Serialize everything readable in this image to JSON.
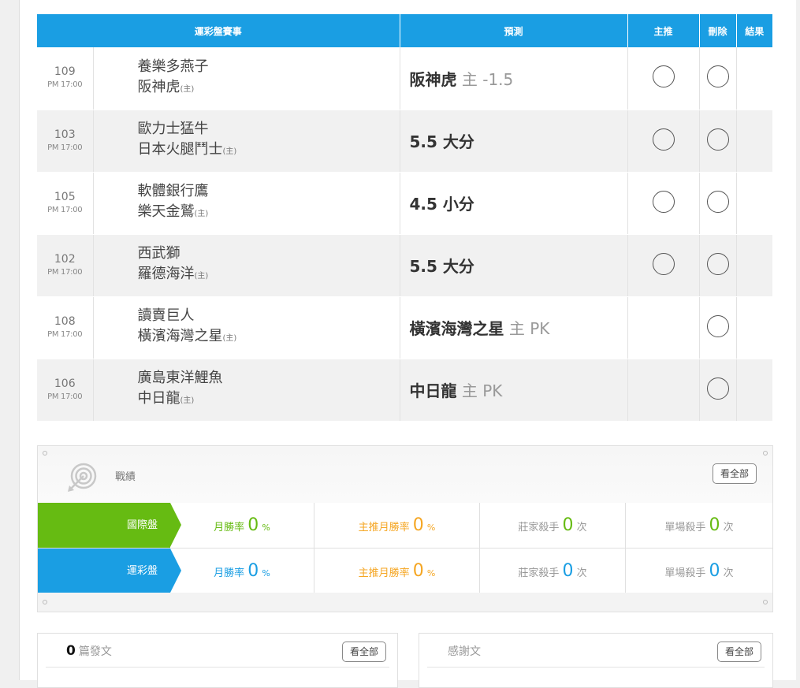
{
  "table": {
    "headers": {
      "event": "運彩盤賽事",
      "prediction": "預測",
      "main": "主推",
      "delete": "刪除",
      "result": "結果"
    },
    "rows": [
      {
        "num": "109",
        "time": "PM 17:00",
        "away": "養樂多燕子",
        "home": "阪神虎",
        "host_mark": "(主)",
        "pred_main": "阪神虎",
        "pred_host": "主",
        "pred_line": "-1.5",
        "has_main_radio": true
      },
      {
        "num": "103",
        "time": "PM 17:00",
        "away": "歐力士猛牛",
        "home": "日本火腿鬥士",
        "host_mark": "(主)",
        "pred_main": "5.5 大分",
        "pred_host": "",
        "pred_line": "",
        "has_main_radio": true
      },
      {
        "num": "105",
        "time": "PM 17:00",
        "away": "軟體銀行鷹",
        "home": "樂天金鷲",
        "host_mark": "(主)",
        "pred_main": "4.5 小分",
        "pred_host": "",
        "pred_line": "",
        "has_main_radio": true
      },
      {
        "num": "102",
        "time": "PM 17:00",
        "away": "西武獅",
        "home": "羅德海洋",
        "host_mark": "(主)",
        "pred_main": "5.5 大分",
        "pred_host": "",
        "pred_line": "",
        "has_main_radio": true
      },
      {
        "num": "108",
        "time": "PM 17:00",
        "away": "讀賣巨人",
        "home": "橫濱海灣之星",
        "host_mark": "(主)",
        "pred_main": "橫濱海灣之星",
        "pred_host": "主",
        "pred_line": "PK",
        "has_main_radio": false
      },
      {
        "num": "106",
        "time": "PM 17:00",
        "away": "廣島東洋鯉魚",
        "home": "中日龍",
        "host_mark": "(主)",
        "pred_main": "中日龍",
        "pred_host": "主",
        "pred_line": "PK",
        "has_main_radio": false
      }
    ]
  },
  "record": {
    "title": "戰績",
    "view_all": "看全部",
    "rows": [
      {
        "tag": "國際盤",
        "color": "#66bb12",
        "month_label": "月勝率",
        "month_value": "0",
        "month_unit": "%",
        "main_label": "主推月勝率",
        "main_value": "0",
        "main_unit": "%",
        "killer_label": "莊家殺手",
        "killer_value": "0",
        "killer_unit": "次",
        "single_label": "單場殺手",
        "single_value": "0",
        "single_unit": "次"
      },
      {
        "tag": "運彩盤",
        "color": "#1a9ee3",
        "month_label": "月勝率",
        "month_value": "0",
        "month_unit": "%",
        "main_label": "主推月勝率",
        "main_value": "0",
        "main_unit": "%",
        "killer_label": "莊家殺手",
        "killer_value": "0",
        "killer_unit": "次",
        "single_label": "單場殺手",
        "single_value": "0",
        "single_unit": "次"
      }
    ]
  },
  "posts": {
    "count": "0",
    "label": "篇發文",
    "view_all": "看全部"
  },
  "thanks": {
    "label": "感謝文",
    "view_all": "看全部"
  },
  "icons": {
    "record": "target-icon"
  }
}
